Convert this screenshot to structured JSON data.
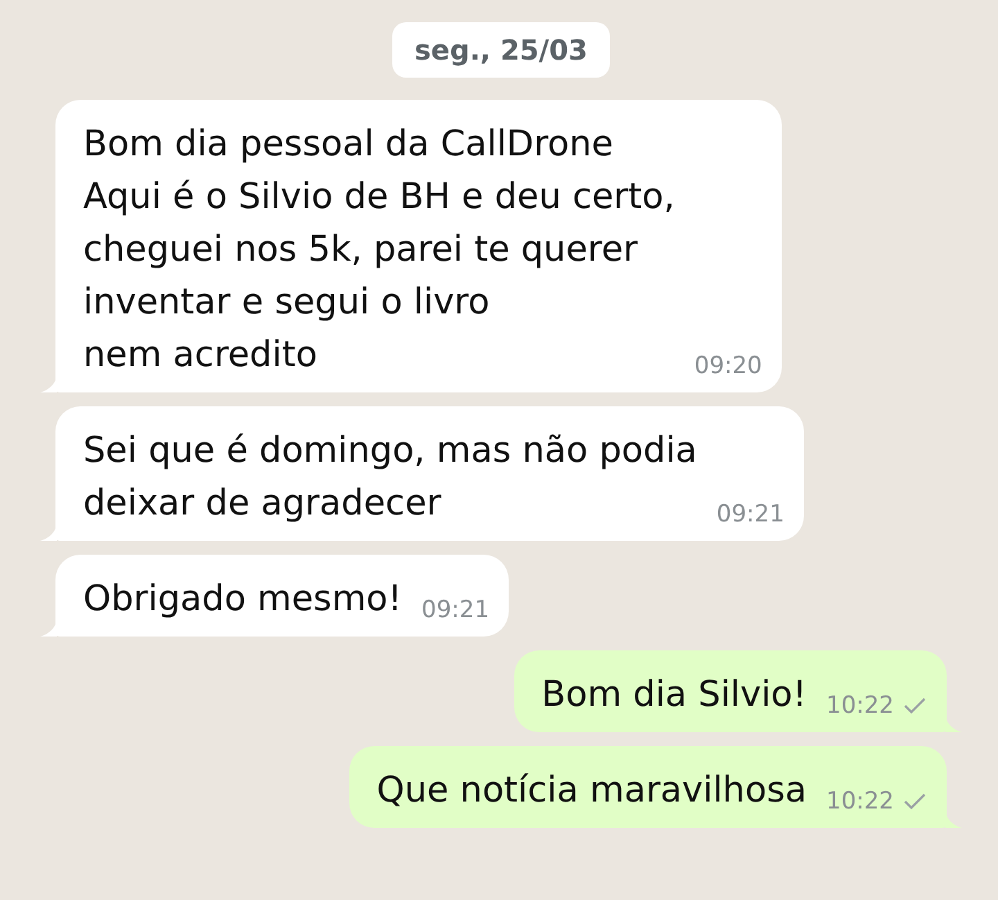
{
  "date": "seg., 25/03",
  "messages": [
    {
      "kind": "incoming",
      "lines": [
        "Bom dia pessoal da CallDrone",
        "Aqui é o Silvio de BH e deu certo,",
        "cheguei nos 5k, parei te querer",
        "inventar e segui o livro",
        "nem acredito"
      ],
      "time": "09:20"
    },
    {
      "kind": "incoming",
      "lines": [
        "Sei que é domingo, mas não podia",
        "deixar de agradecer"
      ],
      "time": "09:21"
    },
    {
      "kind": "incoming",
      "lines": [
        "Obrigado mesmo!"
      ],
      "time": "09:21"
    },
    {
      "kind": "outgoing",
      "lines": [
        "Bom dia Silvio!"
      ],
      "time": "10:22",
      "sent": true
    },
    {
      "kind": "outgoing",
      "lines": [
        "Que notícia maravilhosa"
      ],
      "time": "10:22",
      "sent": true
    }
  ]
}
